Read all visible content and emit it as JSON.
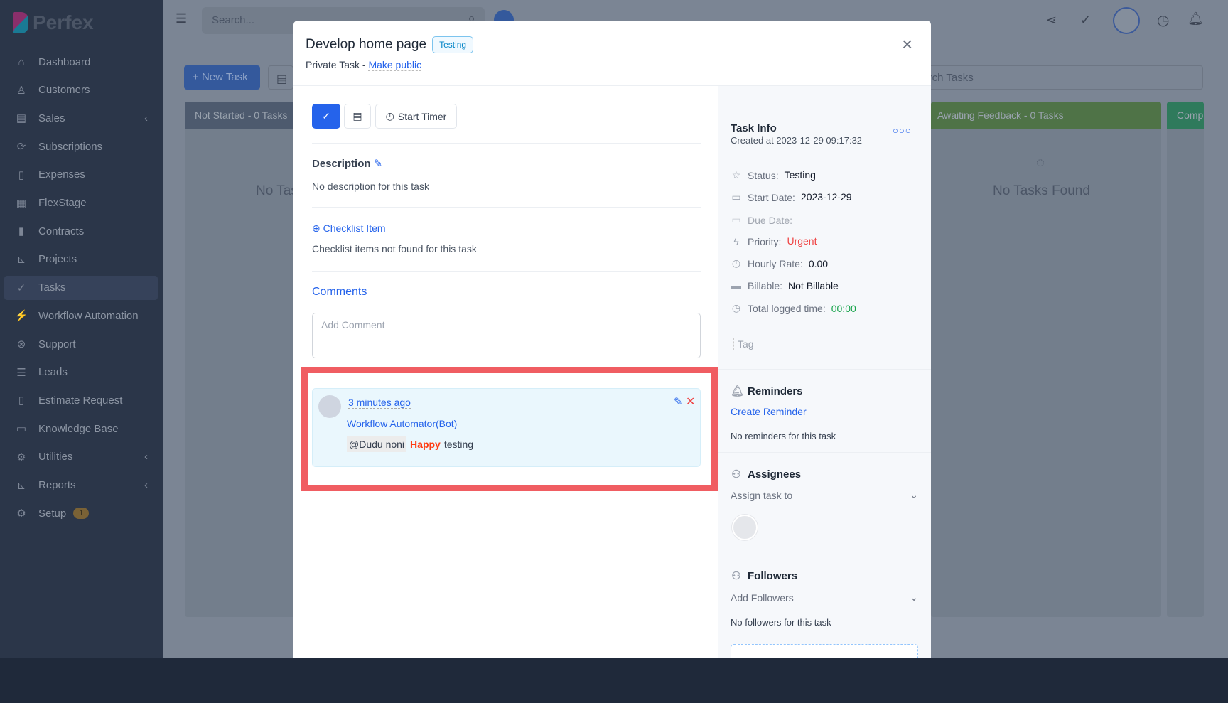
{
  "app": {
    "logo": "Perfex"
  },
  "sidebar": {
    "items": [
      {
        "label": "Dashboard",
        "icon": "home-icon",
        "glyph": "⌂"
      },
      {
        "label": "Customers",
        "icon": "user-icon",
        "glyph": "♙"
      },
      {
        "label": "Sales",
        "icon": "receipt-icon",
        "glyph": "▤",
        "chevron": true
      },
      {
        "label": "Subscriptions",
        "icon": "refresh-icon",
        "glyph": "⟳"
      },
      {
        "label": "Expenses",
        "icon": "document-icon",
        "glyph": "▯"
      },
      {
        "label": "FlexStage",
        "icon": "calendar-icon",
        "glyph": "▦"
      },
      {
        "label": "Contracts",
        "icon": "contract-icon",
        "glyph": "▮"
      },
      {
        "label": "Projects",
        "icon": "chart-icon",
        "glyph": "⊾"
      },
      {
        "label": "Tasks",
        "icon": "check-circle-icon",
        "glyph": "✓",
        "active": true
      },
      {
        "label": "Workflow Automation",
        "icon": "wand-icon",
        "glyph": "⚡"
      },
      {
        "label": "Support",
        "icon": "lifebuoy-icon",
        "glyph": "⊗"
      },
      {
        "label": "Leads",
        "icon": "funnel-icon",
        "glyph": "☰"
      },
      {
        "label": "Estimate Request",
        "icon": "file-icon",
        "glyph": "▯"
      },
      {
        "label": "Knowledge Base",
        "icon": "folder-icon",
        "glyph": "▭"
      },
      {
        "label": "Utilities",
        "icon": "cogs-icon",
        "glyph": "⚙",
        "chevron": true
      },
      {
        "label": "Reports",
        "icon": "bar-chart-icon",
        "glyph": "⊾",
        "chevron": true
      },
      {
        "label": "Setup",
        "icon": "gear-icon",
        "glyph": "⚙",
        "badge": "1"
      }
    ]
  },
  "topbar": {
    "search_placeholder": "Search...",
    "search_tasks_placeholder": "Search Tasks"
  },
  "background": {
    "new_task": "New Task",
    "columns": [
      {
        "label": "Not Started - 0 Tasks",
        "empty": "No Tasks Found",
        "color": "#4d5a6e"
      },
      {
        "label": "Awaiting Feedback - 0 Tasks",
        "empty": "No Tasks Found",
        "color": "#4f7347"
      },
      {
        "label": "Complete",
        "color": "#2f7a5c"
      }
    ]
  },
  "modal": {
    "title": "Develop home page",
    "status_badge": "Testing",
    "privacy": "Private Task - ",
    "make_public": "Make public",
    "start_timer": "Start Timer",
    "description_heading": "Description",
    "description_text": "No description for this task",
    "checklist_add": "Checklist Item",
    "checklist_empty": "Checklist items not found for this task",
    "comments_heading": "Comments",
    "comment_placeholder": "Add Comment",
    "comment": {
      "time": "3 minutes ago",
      "author": "Workflow Automator(Bot)",
      "mention": "@Dudu noni",
      "highlight": "Happy",
      "text": "testing"
    },
    "highlight_color": "#f05d62"
  },
  "task_info": {
    "heading": "Task Info",
    "created": "Created at 2023-12-29 09:17:32",
    "fields": [
      {
        "label": "Status:",
        "value": "Testing",
        "icon": "star-icon"
      },
      {
        "label": "Start Date:",
        "value": "2023-12-29",
        "icon": "calendar-icon"
      },
      {
        "label": "Due Date:",
        "value": "",
        "icon": "calendar-check-icon"
      },
      {
        "label": "Priority:",
        "value": "Urgent",
        "icon": "bolt-icon",
        "color": "#ef4444"
      },
      {
        "label": "Hourly Rate:",
        "value": "0.00",
        "icon": "clock-icon"
      },
      {
        "label": "Billable:",
        "value": "Not Billable",
        "icon": "credit-card-icon"
      },
      {
        "label": "Total logged time:",
        "value": "00:00",
        "icon": "clock-icon",
        "color": "#16a34a"
      }
    ],
    "tag_placeholder": "Tag",
    "reminders": {
      "heading": "Reminders",
      "create": "Create Reminder",
      "empty": "No reminders for this task"
    },
    "assignees": {
      "heading": "Assignees",
      "select": "Assign task to"
    },
    "followers": {
      "heading": "Followers",
      "select": "Add Followers",
      "empty": "No followers for this task"
    }
  }
}
